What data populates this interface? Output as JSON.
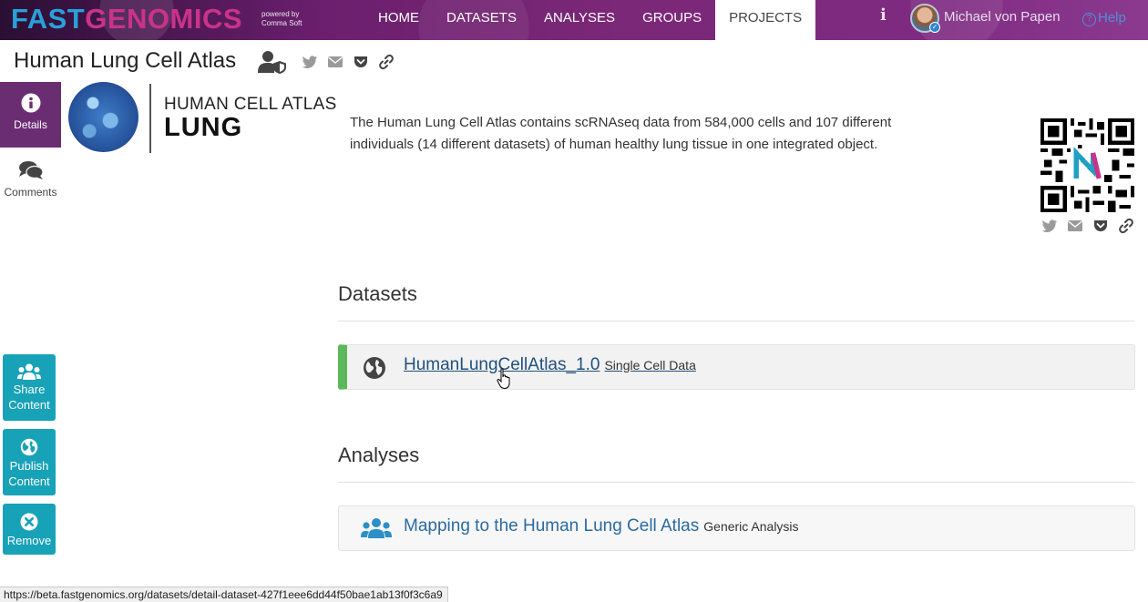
{
  "navbar": {
    "brand_part1": "FAST",
    "brand_part2": "GENOMICS",
    "powered_line1": "powered by",
    "powered_line2": "Comma Soft",
    "links": [
      {
        "label": "HOME"
      },
      {
        "label": "DATASETS"
      },
      {
        "label": "ANALYSES"
      },
      {
        "label": "GROUPS"
      },
      {
        "label": "PROJECTS"
      }
    ],
    "active_link": "PROJECTS",
    "info_icon": "info-icon",
    "user_name": "Michael von Papen",
    "help_label": "Help"
  },
  "page": {
    "title": "Human Lung Cell Atlas",
    "title_icons": [
      "user-shield-icon",
      "twitter-icon",
      "envelope-icon",
      "pocket-icon",
      "link-icon"
    ]
  },
  "tabs": {
    "details_label": "Details",
    "comments_label": "Comments"
  },
  "logo": {
    "line1": "HUMAN CELL ATLAS",
    "line2": "LUNG"
  },
  "description": "The Human Lung Cell Atlas contains scRNAseq data from 584,000 cells and 107 different individuals (14 different datasets) of human healthy lung tissue in one integrated object.",
  "datasets": {
    "heading": "Datasets",
    "items": [
      {
        "name": "HumanLungCellAtlas_1.0",
        "type": "Single Cell Data",
        "icon": "globe-icon",
        "accent": "#5cb85c"
      }
    ]
  },
  "analyses": {
    "heading": "Analyses",
    "items": [
      {
        "name": "Mapping to the Human Lung Cell Atlas",
        "type": "Generic Analysis",
        "icon": "users-icon"
      }
    ]
  },
  "actions": {
    "share_line1": "Share",
    "share_line2": "Content",
    "publish_line1": "Publish",
    "publish_line2": "Content",
    "remove_label": "Remove"
  },
  "status_url": "https://beta.fastgenomics.org/datasets/detail-dataset-427f1eee6dd44f50bae1ab13f0f3c6a9",
  "colors": {
    "navbar_purple": "#6b1f6e",
    "details_tab": "#6b2d72",
    "action_teal": "#17a2b8",
    "link_blue": "#2c6aa0",
    "dataset_accent": "#5cb85c"
  }
}
